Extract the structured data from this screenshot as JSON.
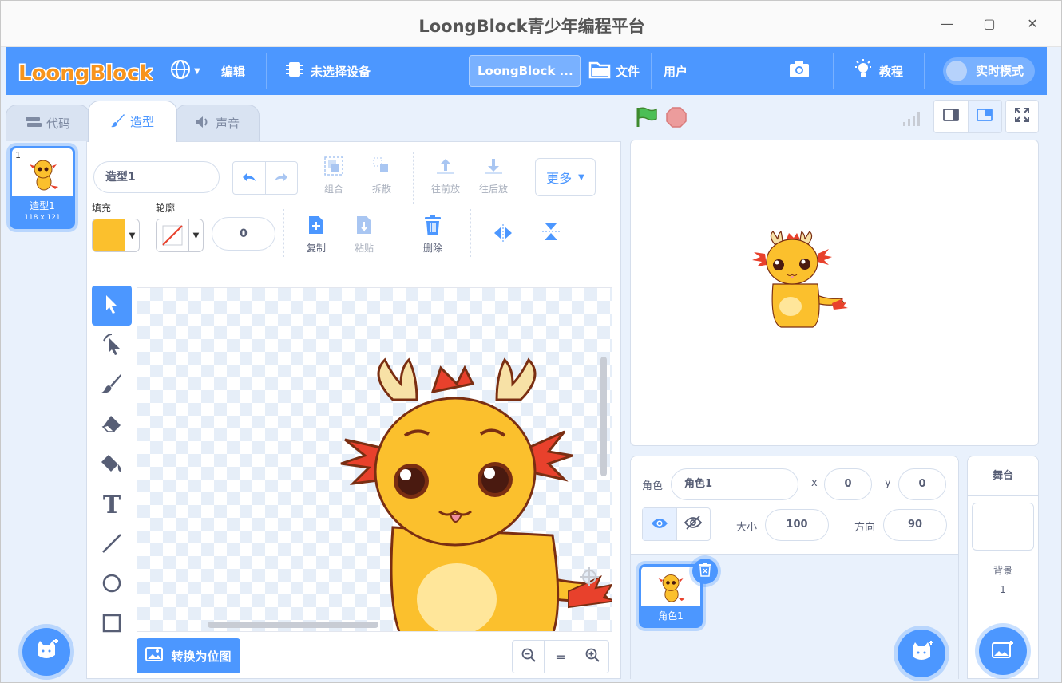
{
  "window": {
    "title": "LoongBlock青少年编程平台"
  },
  "menubar": {
    "logo_text": "LoongBlock",
    "edit": "编辑",
    "device": "未选择设备",
    "project_title": "LoongBlock ...",
    "file": "文件",
    "user": "用户",
    "tutorial": "教程",
    "realtime_mode": "实时模式"
  },
  "tabs": [
    {
      "label": "代码"
    },
    {
      "label": "造型"
    },
    {
      "label": "声音"
    }
  ],
  "costumes": [
    {
      "index": "1",
      "name": "造型1",
      "size": "118 x 121"
    }
  ],
  "editor": {
    "costume_name": "造型1",
    "group": "组合",
    "ungroup": "拆散",
    "forward": "往前放",
    "backward": "往后放",
    "more": "更多",
    "fill_label": "填充",
    "outline_label": "轮廓",
    "outline_width": "0",
    "copy": "复制",
    "paste": "粘贴",
    "delete": "删除",
    "convert": "转换为位图",
    "zoom_reset": "="
  },
  "sprite": {
    "label": "角色",
    "name": "角色1",
    "x_label": "x",
    "x": "0",
    "y_label": "y",
    "y": "0",
    "size_label": "大小",
    "size": "100",
    "direction_label": "方向",
    "direction": "90",
    "tile_name": "角色1"
  },
  "stage_panel": {
    "title": "舞台",
    "backdrop_label": "背景",
    "backdrop_count": "1"
  },
  "colors": {
    "accent": "#4c97ff",
    "fill": "#fbc02d",
    "bg": "#e9f1fc"
  }
}
